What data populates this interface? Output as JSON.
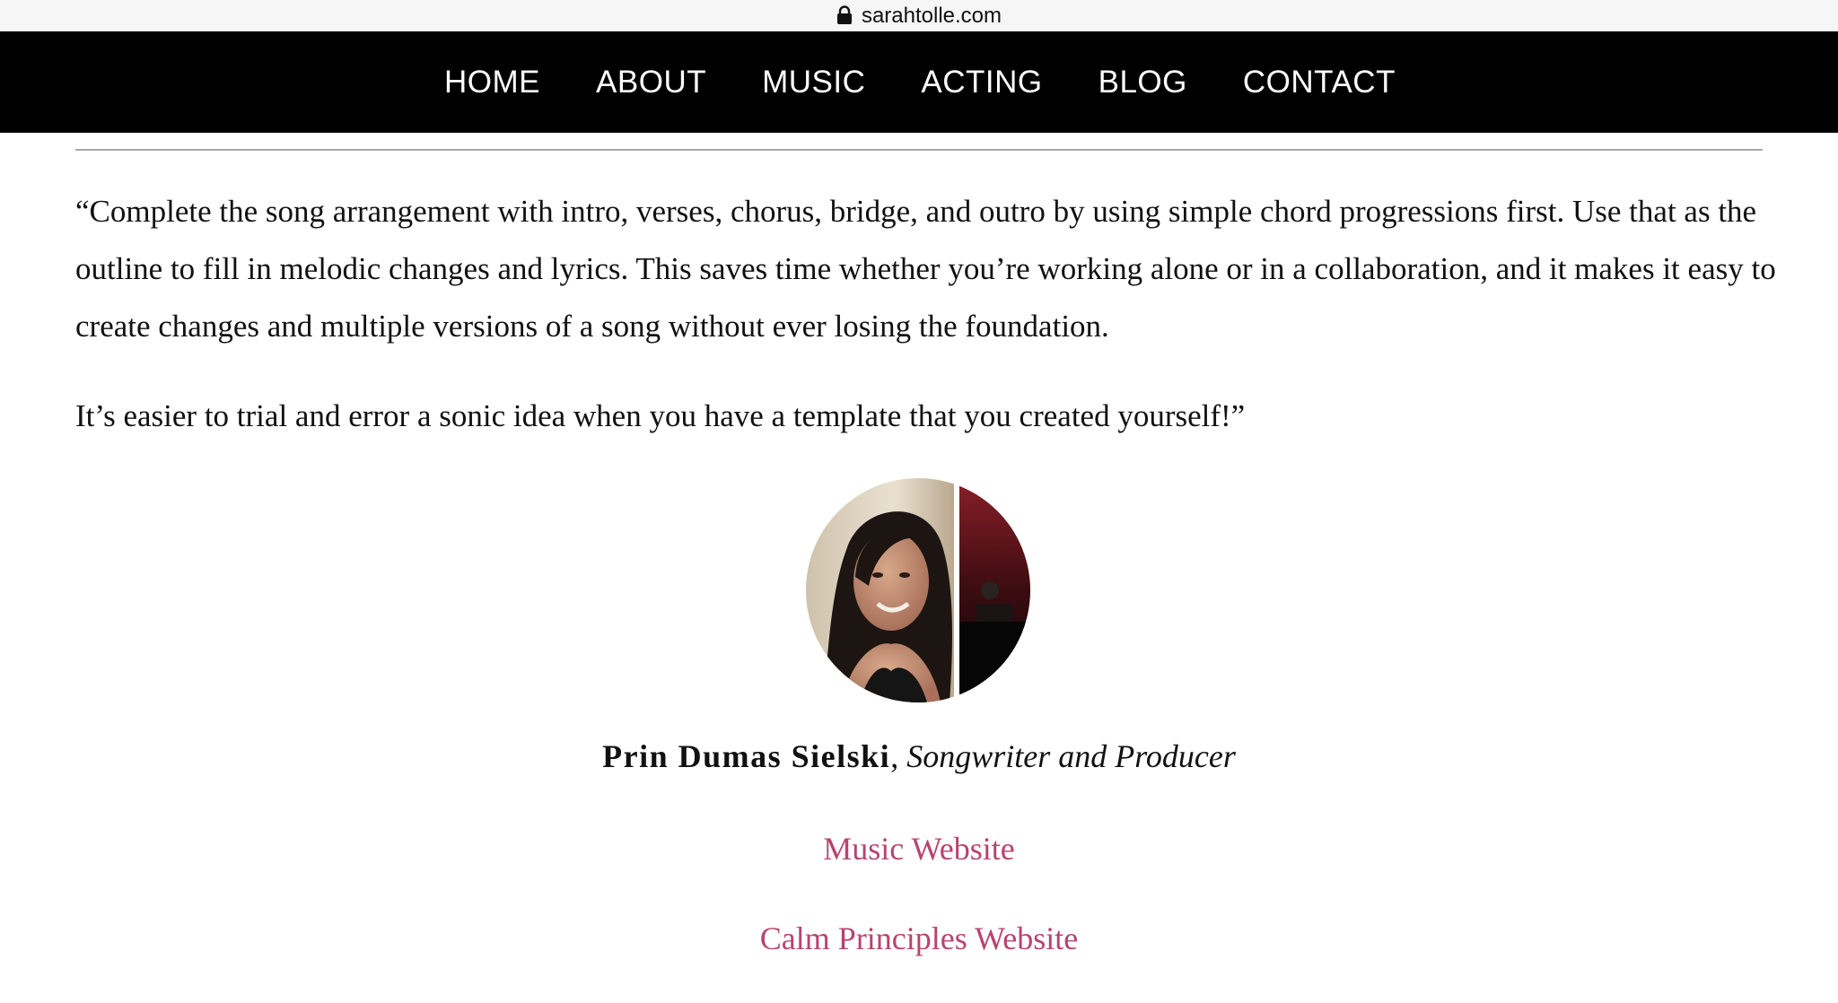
{
  "browser": {
    "url": "sarahtolle.com",
    "lock_icon": "lock-icon"
  },
  "nav": {
    "items": [
      {
        "label": "HOME"
      },
      {
        "label": "ABOUT"
      },
      {
        "label": "MUSIC"
      },
      {
        "label": "ACTING"
      },
      {
        "label": "BLOG"
      },
      {
        "label": "CONTACT"
      }
    ]
  },
  "testimonial": {
    "paragraph_1": "“Complete the song arrangement with intro, verses, chorus, bridge, and outro by using simple chord progressions first. Use that as the outline to fill in melodic changes and lyrics. This saves time whether you’re working alone or in a collaboration, and it makes it easy to create changes and multiple versions of a song without ever losing the foundation.",
    "paragraph_2": "It’s easier to trial and error a sonic idea when you have a template that you created yourself!”",
    "author_name": "Prin Dumas Sielski",
    "separator": ", ",
    "author_role": "Songwriter and Producer"
  },
  "links": {
    "music_website": "Music Website",
    "calm_website": "Calm Principles Website"
  },
  "colors": {
    "nav_background": "#000000",
    "link": "#b8446e",
    "divider": "#a9a9a9"
  }
}
